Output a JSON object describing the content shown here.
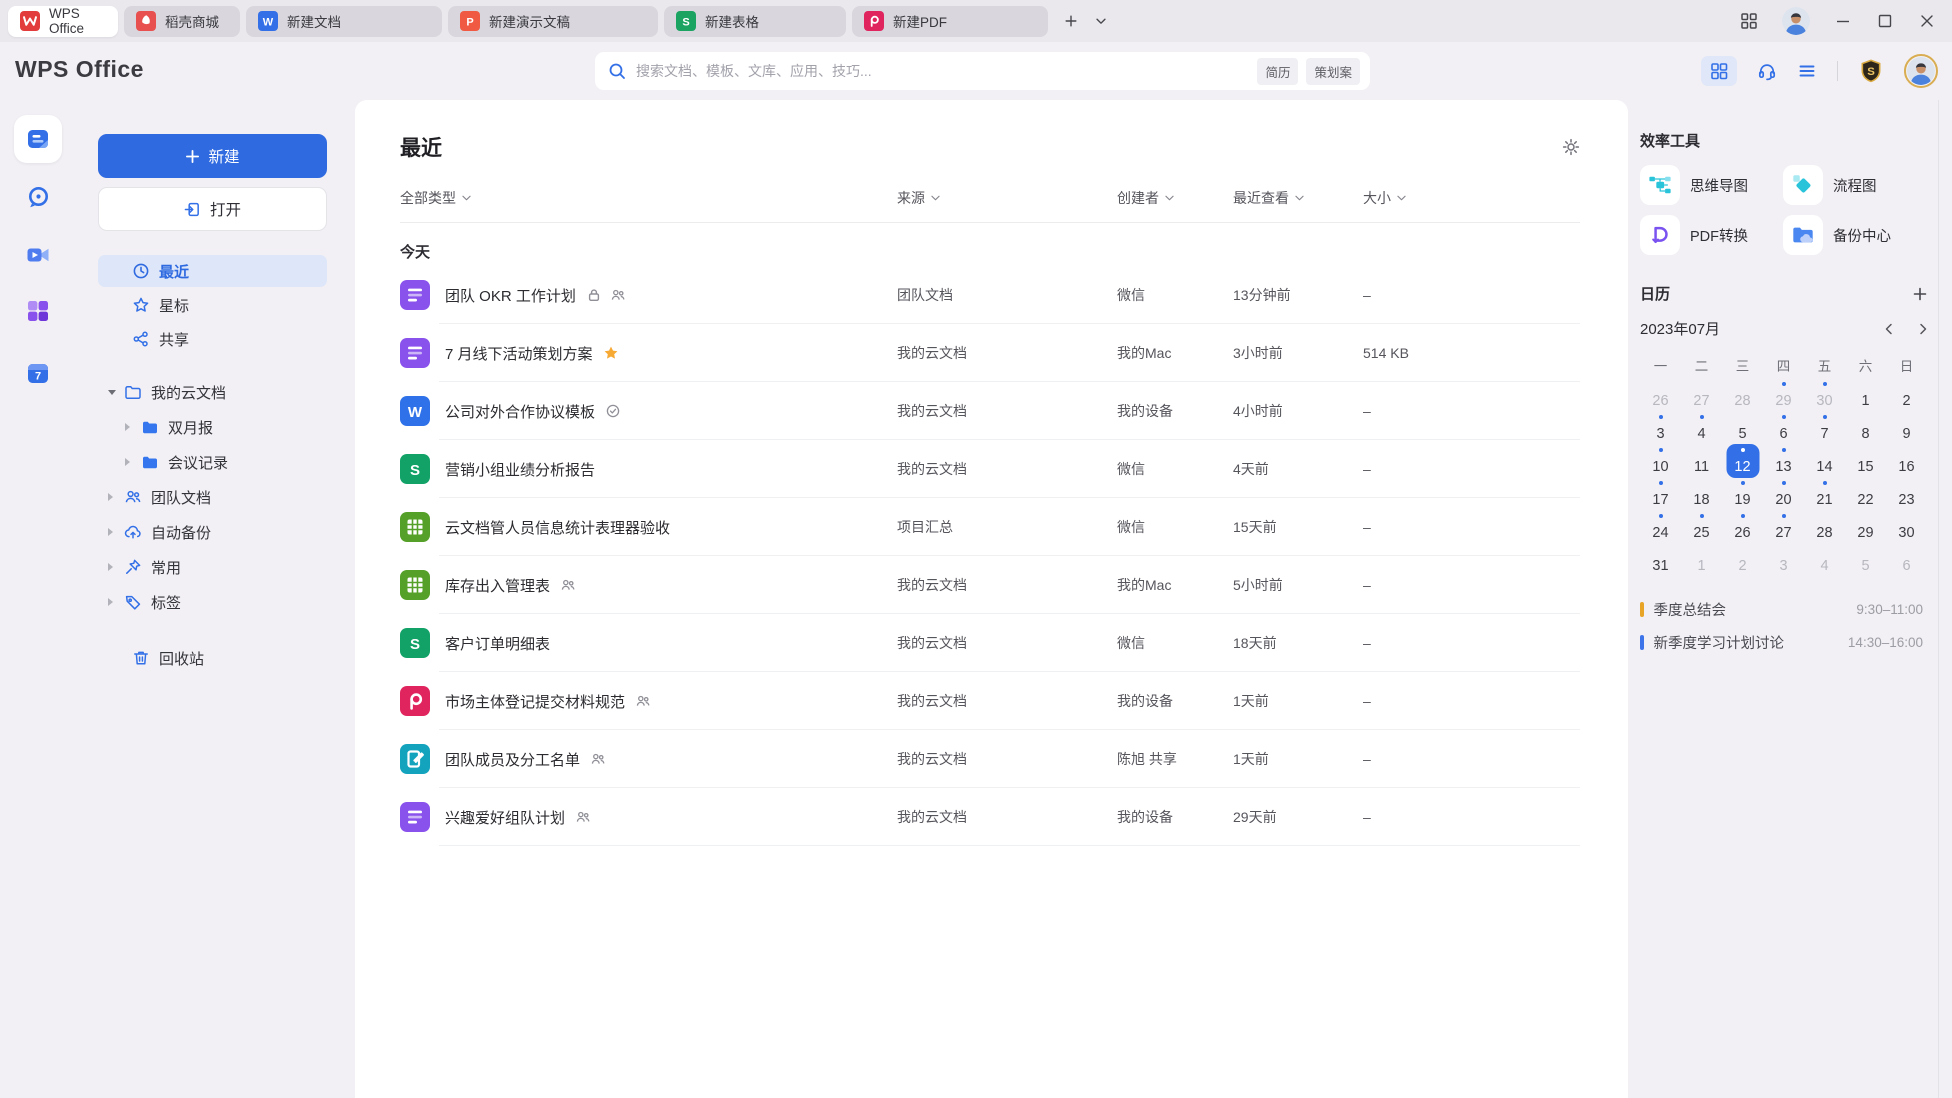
{
  "colors": {
    "accent": "#3370e7",
    "star": "#f6a933",
    "event_orange": "#e8a427",
    "event_blue": "#3d74ea"
  },
  "window": {
    "tabs": [
      {
        "label": "WPS Office",
        "icon": "wps",
        "active": true
      },
      {
        "label": "稻壳商城",
        "icon": "docer",
        "active": false
      },
      {
        "label": "新建文档",
        "icon": "writer",
        "active": false
      },
      {
        "label": "新建演示文稿",
        "icon": "slides",
        "active": false
      },
      {
        "label": "新建表格",
        "icon": "sheet",
        "active": false
      },
      {
        "label": "新建PDF",
        "icon": "pdftab",
        "active": false
      }
    ]
  },
  "header": {
    "logo": "WPS Office",
    "search": {
      "placeholder": "搜索文档、模板、文库、应用、技巧...",
      "tags": [
        "简历",
        "策划案"
      ]
    }
  },
  "sidebar": {
    "new_button": "新建",
    "open_button": "打开",
    "nav": [
      {
        "label": "最近",
        "icon": "clock",
        "active": true
      },
      {
        "label": "星标",
        "icon": "starnav",
        "active": false
      },
      {
        "label": "共享",
        "icon": "share",
        "active": false
      }
    ],
    "tree": [
      {
        "label": "我的云文档",
        "icon": "folder-cloud",
        "expanded": true
      },
      {
        "label": "双月报",
        "icon": "folder-fill",
        "child": true
      },
      {
        "label": "会议记录",
        "icon": "folder-fill",
        "child": true
      },
      {
        "label": "团队文档",
        "icon": "team"
      },
      {
        "label": "自动备份",
        "icon": "cloud-backup"
      },
      {
        "label": "常用",
        "icon": "pin"
      },
      {
        "label": "标签",
        "icon": "tag"
      }
    ],
    "trash": "回收站"
  },
  "main": {
    "title": "最近",
    "filters": [
      "全部类型",
      "来源",
      "创建者",
      "最近查看",
      "大小"
    ],
    "section": "今天",
    "files": [
      {
        "name": "团队 OKR 工作计划",
        "icon": "doc-purple",
        "badges": [
          "lock",
          "people"
        ],
        "source": "团队文档",
        "creator": "微信",
        "viewed": "13分钟前",
        "size": "–"
      },
      {
        "name": "7 月线下活动策划方案",
        "icon": "doc-purple",
        "badges": [
          "star"
        ],
        "source": "我的云文档",
        "creator": "我的Mac",
        "viewed": "3小时前",
        "size": "514 KB"
      },
      {
        "name": "公司对外合作协议模板",
        "icon": "word",
        "badges": [
          "verified"
        ],
        "source": "我的云文档",
        "creator": "我的设备",
        "viewed": "4小时前",
        "size": "–"
      },
      {
        "name": "营销小组业绩分析报告",
        "icon": "sheet-s",
        "badges": [],
        "source": "我的云文档",
        "creator": "微信",
        "viewed": "4天前",
        "size": "–"
      },
      {
        "name": "云文档管人员信息统计表理器验收",
        "icon": "sheet-grid",
        "badges": [],
        "source": "项目汇总",
        "creator": "微信",
        "viewed": "15天前",
        "size": "–"
      },
      {
        "name": "库存出入管理表",
        "icon": "sheet-grid",
        "badges": [
          "people"
        ],
        "source": "我的云文档",
        "creator": "我的Mac",
        "viewed": "5小时前",
        "size": "–"
      },
      {
        "name": "客户订单明细表",
        "icon": "sheet-s",
        "badges": [],
        "source": "我的云文档",
        "creator": "微信",
        "viewed": "18天前",
        "size": "–"
      },
      {
        "name": "市场主体登记提交材料规范",
        "icon": "pdf",
        "badges": [
          "people"
        ],
        "source": "我的云文档",
        "creator": "我的设备",
        "viewed": "1天前",
        "size": "–"
      },
      {
        "name": "团队成员及分工名单",
        "icon": "form-teal",
        "badges": [
          "people"
        ],
        "source": "我的云文档",
        "creator": "陈旭 共享",
        "viewed": "1天前",
        "size": "–"
      },
      {
        "name": "兴趣爱好组队计划",
        "icon": "doc-purple",
        "badges": [
          "people"
        ],
        "source": "我的云文档",
        "creator": "我的设备",
        "viewed": "29天前",
        "size": "–"
      }
    ]
  },
  "right_panel": {
    "tools_title": "效率工具",
    "tools": [
      {
        "label": "思维导图",
        "icon": "mindmap"
      },
      {
        "label": "流程图",
        "icon": "flowchart"
      },
      {
        "label": "PDF转换",
        "icon": "pdfconvert"
      },
      {
        "label": "备份中心",
        "icon": "backup"
      }
    ],
    "calendar": {
      "title": "日历",
      "month": "2023年07月",
      "weekdays": [
        "一",
        "二",
        "三",
        "四",
        "五",
        "六",
        "日"
      ],
      "days": [
        {
          "d": "26",
          "muted": true
        },
        {
          "d": "27",
          "muted": true
        },
        {
          "d": "28",
          "muted": true
        },
        {
          "d": "29",
          "muted": true,
          "dot": true
        },
        {
          "d": "30",
          "muted": true,
          "dot": true
        },
        {
          "d": "1"
        },
        {
          "d": "2"
        },
        {
          "d": "3",
          "dot": true
        },
        {
          "d": "4",
          "dot": true
        },
        {
          "d": "5"
        },
        {
          "d": "6",
          "dot": true
        },
        {
          "d": "7",
          "dot": true
        },
        {
          "d": "8"
        },
        {
          "d": "9"
        },
        {
          "d": "10",
          "dot": true
        },
        {
          "d": "11"
        },
        {
          "d": "12",
          "selected": true,
          "dot": true
        },
        {
          "d": "13",
          "dot": true
        },
        {
          "d": "14"
        },
        {
          "d": "15"
        },
        {
          "d": "16"
        },
        {
          "d": "17",
          "dot": true
        },
        {
          "d": "18"
        },
        {
          "d": "19",
          "dot": true
        },
        {
          "d": "20",
          "dot": true
        },
        {
          "d": "21",
          "dot": true
        },
        {
          "d": "22"
        },
        {
          "d": "23"
        },
        {
          "d": "24",
          "dot": true
        },
        {
          "d": "25",
          "dot": true
        },
        {
          "d": "26",
          "dot": true
        },
        {
          "d": "27",
          "dot": true
        },
        {
          "d": "28"
        },
        {
          "d": "29"
        },
        {
          "d": "30"
        },
        {
          "d": "31"
        },
        {
          "d": "1",
          "muted": true
        },
        {
          "d": "2",
          "muted": true
        },
        {
          "d": "3",
          "muted": true
        },
        {
          "d": "4",
          "muted": true
        },
        {
          "d": "5",
          "muted": true
        },
        {
          "d": "6",
          "muted": true
        }
      ],
      "events": [
        {
          "title": "季度总结会",
          "time": "9:30–11:00",
          "color": "#e8a427"
        },
        {
          "title": "新季度学习计划讨论",
          "time": "14:30–16:00",
          "color": "#3d74ea"
        }
      ]
    }
  }
}
